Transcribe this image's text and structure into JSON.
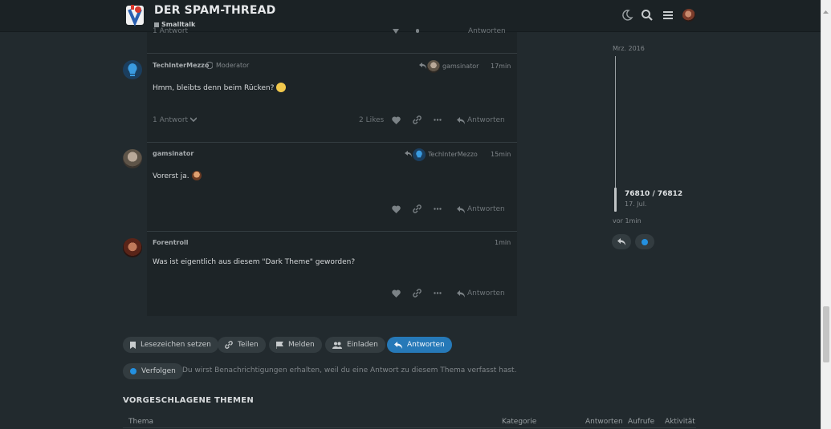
{
  "header": {
    "title": "DER SPAM-THREAD",
    "category": "Smalltalk"
  },
  "top_post_fragment": {
    "replies": "1 Antwort",
    "reply": "Antworten"
  },
  "posts": [
    {
      "username": "TechInterMezzo",
      "role": "Moderator",
      "reply_to": "gamsinator",
      "time": "17min",
      "text": "Hmm, bleibts denn beim Rücken?",
      "replies": "1 Antwort",
      "likes": "2 Likes",
      "reply": "Antworten"
    },
    {
      "username": "gamsinator",
      "reply_to": "TechInterMezzo",
      "time": "15min",
      "text": "Vorerst ja.",
      "reply": "Antworten"
    },
    {
      "username": "Forentroll",
      "time": "1min",
      "text": "Was ist eigentlich aus diesem \"Dark Theme\" geworden?",
      "reply": "Antworten"
    }
  ],
  "timeline": {
    "start_date": "Mrz. 2016",
    "position": "76810 / 76812",
    "position_date": "17. Jul.",
    "last_activity": "vor 1min"
  },
  "footer_buttons": {
    "bookmark": "Lesezeichen setzen",
    "share": "Teilen",
    "flag": "Melden",
    "invite": "Einladen",
    "reply": "Antworten"
  },
  "notifications": {
    "level": "Verfolgen",
    "text": "Du wirst Benachrichtigungen erhalten, weil du eine Antwort zu diesem Thema verfasst hast."
  },
  "suggested": {
    "heading": "VORGESCHLAGENE THEMEN",
    "columns": [
      "Thema",
      "Kategorie",
      "Antworten",
      "Aufrufe",
      "Aktivität"
    ]
  },
  "colors": {
    "accent": "#2679b8",
    "background": "#222a2e",
    "post_background": "#1d2427"
  }
}
